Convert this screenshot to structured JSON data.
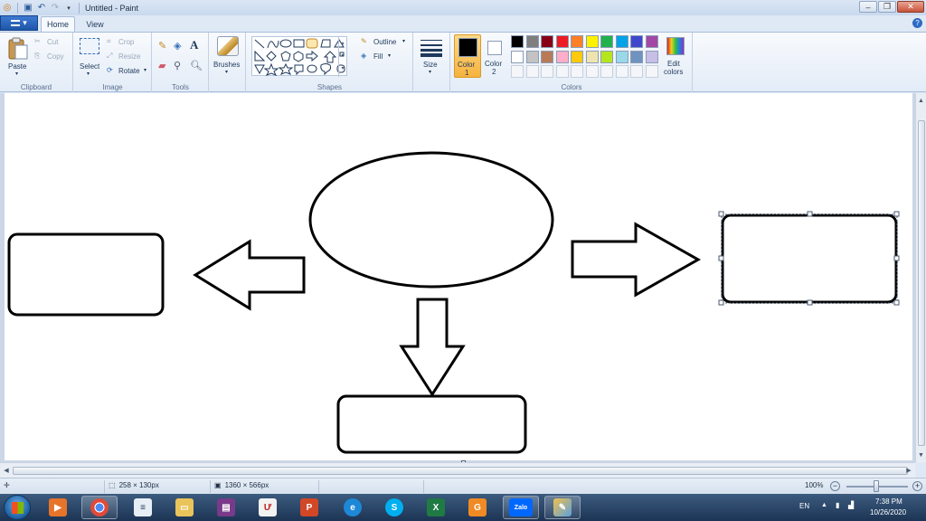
{
  "window": {
    "title": "Untitled - Paint"
  },
  "menu_button": {
    "label": "▾"
  },
  "tabs": [
    {
      "label": "Home",
      "active": true
    },
    {
      "label": "View",
      "active": false
    }
  ],
  "clipboard": {
    "paste": "Paste",
    "cut": "Cut",
    "copy": "Copy",
    "group": "Clipboard"
  },
  "image": {
    "select": "Select",
    "crop": "Crop",
    "resize": "Resize",
    "rotate": "Rotate",
    "group": "Image"
  },
  "tools": {
    "group": "Tools"
  },
  "brushes": {
    "label": "Brushes"
  },
  "shapes": {
    "outline": "Outline",
    "fill": "Fill",
    "group": "Shapes"
  },
  "size": {
    "label": "Size"
  },
  "colors": {
    "color1": "Color",
    "color1_num": "1",
    "color2": "Color",
    "color2_num": "2",
    "edit": "Edit",
    "edit2": "colors",
    "group": "Colors",
    "color1_value": "#000000",
    "color2_value": "#ffffff",
    "palette_row1": [
      "#000000",
      "#7f7f7f",
      "#880015",
      "#ed1c24",
      "#ff7f27",
      "#fff200",
      "#22b14c",
      "#00a2e8",
      "#3f48cc",
      "#a349a4"
    ],
    "palette_row2": [
      "#ffffff",
      "#c3c3c3",
      "#b97a57",
      "#ffaec9",
      "#ffc90e",
      "#efe4b0",
      "#b5e61d",
      "#99d9ea",
      "#7092be",
      "#c8bfe7"
    ]
  },
  "status": {
    "selection_size": "258 × 130px",
    "canvas_size": "1360 × 566px",
    "zoom": "100%"
  },
  "tray": {
    "lang": "EN",
    "time": "7:38 PM",
    "date": "10/26/2020"
  }
}
